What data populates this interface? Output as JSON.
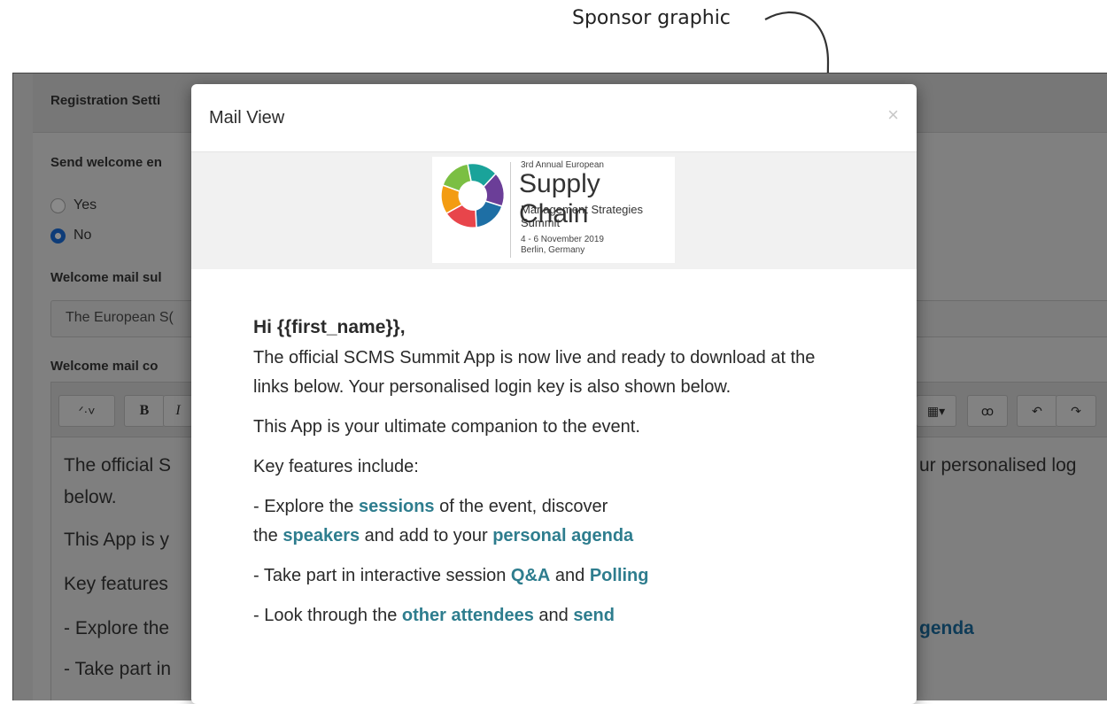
{
  "annotation": {
    "label": "Sponsor graphic"
  },
  "background": {
    "panel_title": "Registration Setti",
    "welcome_label": "Send welcome en",
    "radio_yes": "Yes",
    "radio_no": "No",
    "subject_label": "Welcome mail sul",
    "subject_value": "The European S(",
    "content_label": "Welcome mail co",
    "toolbar": {
      "magic": "ᐟ·˅",
      "bold": "B",
      "italic": "I",
      "table": "▦▾",
      "link": "ꝏ",
      "undo": "↶",
      "redo": "↷"
    },
    "editor_lines": {
      "line1_left": "The official S",
      "line1_right": "ur personalised log",
      "line2": "below.",
      "line3": "This App is y",
      "line4": "Key features",
      "line5_left": "- Explore the",
      "line5_right": "genda",
      "line6": "- Take part in"
    }
  },
  "modal": {
    "title": "Mail View",
    "close": "×",
    "logo": {
      "edition": "3rd Annual European",
      "name": "Supply Chain",
      "subtitle1": "Management Strategies",
      "subtitle2": "Summit",
      "dates": "4 - 6 November 2019",
      "location": "Berlin, Germany"
    },
    "body": {
      "greeting": "Hi {{first_name}},",
      "intro": "The official SCMS Summit App is now live and ready to download at the links below. Your personalised login key is also shown below.",
      "companion": "This App is your ultimate companion to the event.",
      "features_heading": "Key features include:",
      "f1_a": "- Explore the ",
      "f1_link1": "sessions",
      "f1_b": " of the event, discover",
      "f1_c": "the ",
      "f1_link2": "speakers",
      "f1_d": " and add to your ",
      "f1_link3": "personal agenda",
      "f2_a": "- Take part in interactive session ",
      "f2_link1": "Q&A",
      "f2_b": " and ",
      "f2_link2": "Polling",
      "f3_a": "- Look through the ",
      "f3_link1": "other attendees",
      "f3_b": " and ",
      "f3_link2": "send"
    }
  },
  "colors": {
    "link": "#2e7d8e",
    "overlay": "#808080",
    "radio_selected": "#0e3c78"
  }
}
